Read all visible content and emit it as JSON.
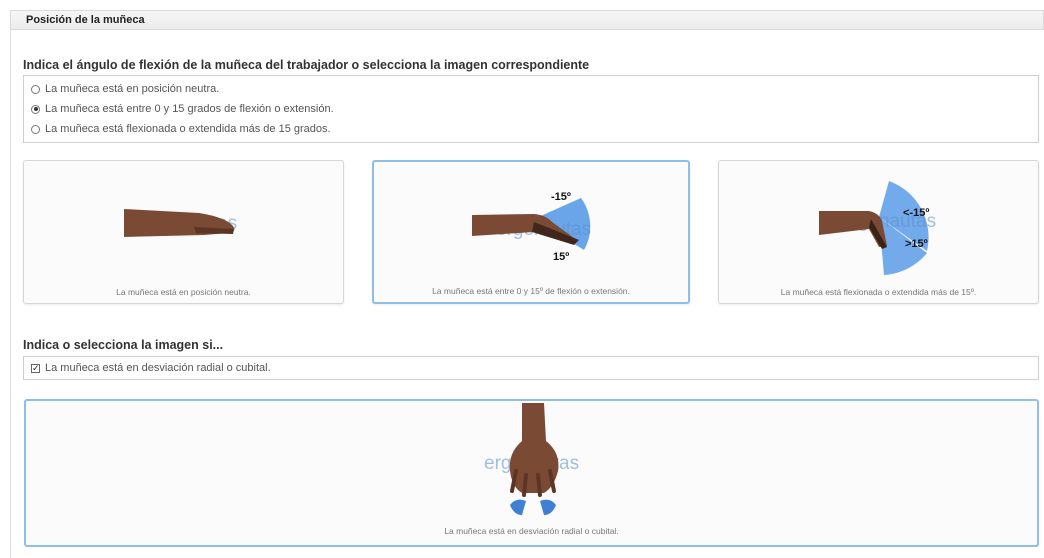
{
  "panel": {
    "title": "Posición de la muñeca"
  },
  "flexion": {
    "question": "Indica el ángulo de flexión de la muñeca del trabajador o selecciona la imagen correspondiente",
    "options": [
      {
        "label": "La muñeca está en posición neutra.",
        "checked": false
      },
      {
        "label": "La muñeca está entre 0 y 15 grados de flexión o extensión.",
        "checked": true
      },
      {
        "label": "La muñeca está flexionada o extendida más de 15 grados.",
        "checked": false
      }
    ],
    "cards": [
      {
        "caption": "La muñeca está en posición neutra.",
        "selected": false
      },
      {
        "caption": "La muñeca está entre 0 y 15º de flexión o extensión.",
        "selected": true,
        "label_top": "-15º",
        "label_bottom": "15º"
      },
      {
        "caption": "La muñeca está flexionada o extendida más de 15º.",
        "selected": false,
        "label_top": "<-15º",
        "label_bottom": ">15º"
      }
    ],
    "watermark": "ergonautas"
  },
  "deviation": {
    "question": "Indica o selecciona la imagen si...",
    "checkbox_label": "La muñeca está en desviación radial o cubital.",
    "checked": true,
    "check_mark": "✓",
    "card_caption": "La muñeca está en desviación radial o cubital.",
    "watermark": "ergonautas"
  },
  "colors": {
    "accent_border": "#8fbfe6",
    "sector_blue": "#5a9be8",
    "skin": "#7a4a35"
  }
}
